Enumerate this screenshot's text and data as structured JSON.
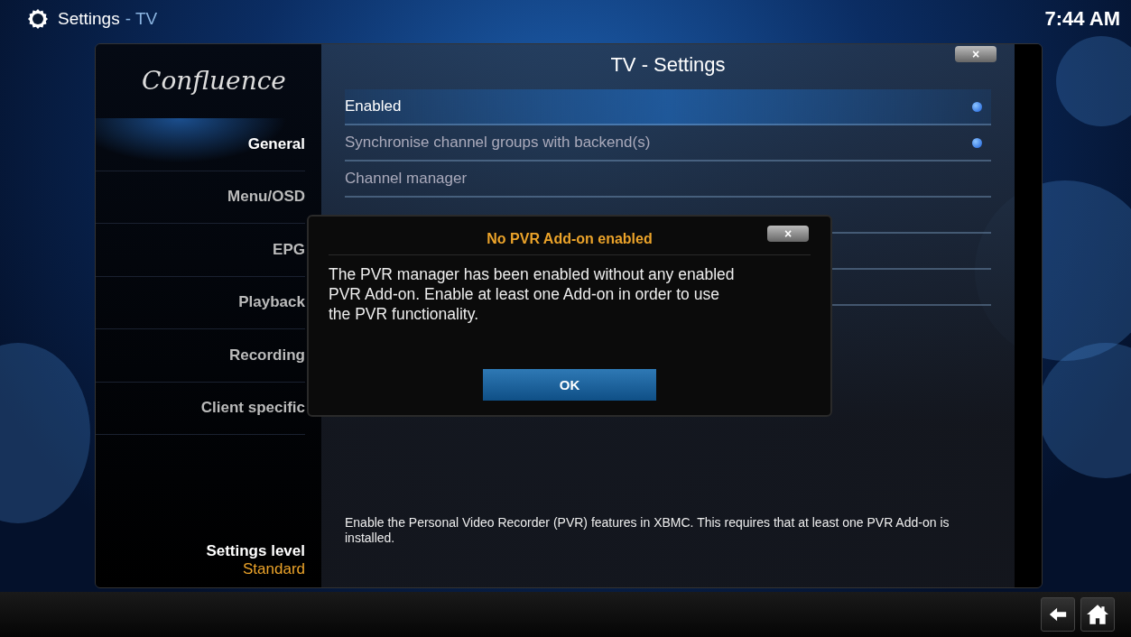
{
  "header": {
    "title": "Settings",
    "subtitle": "- TV",
    "clock": "7:44 AM"
  },
  "sidebar": {
    "logo": "Confluence",
    "items": [
      {
        "label": "General",
        "selected": true
      },
      {
        "label": "Menu/OSD",
        "selected": false
      },
      {
        "label": "EPG",
        "selected": false
      },
      {
        "label": "Playback",
        "selected": false
      },
      {
        "label": "Recording",
        "selected": false
      },
      {
        "label": "Client specific",
        "selected": false
      }
    ],
    "settings_level": {
      "label": "Settings level",
      "value": "Standard"
    }
  },
  "panel": {
    "title": "TV - Settings",
    "close": "×",
    "rows": [
      {
        "kind": "toggle",
        "label": "Enabled",
        "selected": true,
        "on": true
      },
      {
        "kind": "toggle",
        "label": "Synchronise channel groups with backend(s)",
        "selected": false,
        "on": true
      },
      {
        "kind": "action",
        "label": "Channel manager",
        "selected": false
      }
    ],
    "description": "Enable the Personal Video Recorder (PVR) features in XBMC. This requires that at least one PVR Add-on is installed."
  },
  "dialog": {
    "title": "No PVR Add-on enabled",
    "close": "×",
    "message": "The PVR manager has been enabled without any enabled PVR Add-on. Enable at least one Add-on in order to use the PVR functionality.",
    "button": "OK"
  }
}
